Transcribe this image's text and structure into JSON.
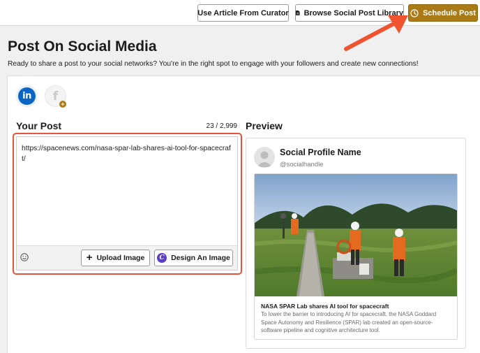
{
  "toolbar": {
    "curator_label": "Use Article From Curator",
    "library_label": "Browse Social Post Library",
    "schedule_label": "Schedule Post",
    "accent_color": "#a97a16",
    "annotation_arrow_color": "#f0532f"
  },
  "header": {
    "title": "Post On Social Media",
    "subtitle": "Ready to share a post to your social networks? You're in the right spot to engage with your followers and create new connections!"
  },
  "networks": [
    {
      "name": "linkedin",
      "glyph": "in",
      "icon": "linkedin-icon",
      "selected": true
    },
    {
      "name": "facebook",
      "glyph": "f",
      "icon": "facebook-icon",
      "selected": false,
      "badge": "+"
    }
  ],
  "post": {
    "title": "Your Post",
    "char_count": "23 / 2,999",
    "text": "https://spacenews.com/nasa-spar-lab-shares-ai-tool-for-spacecraft/",
    "upload_label": "Upload Image",
    "design_label": "Design An Image",
    "design_icon_glyph": "C"
  },
  "preview": {
    "title": "Preview",
    "profile_name": "Social Profile Name",
    "profile_handle": "@socialhandle",
    "link_title": "NASA SPAR Lab shares AI tool for spacecraft",
    "link_description": "To lower the barrier to introducing AI for spacecraft, the NASA Goddard Space Autonomy and Resilience (SPAR) lab created an open-source-software pipeline and cognitive architecture tool."
  }
}
